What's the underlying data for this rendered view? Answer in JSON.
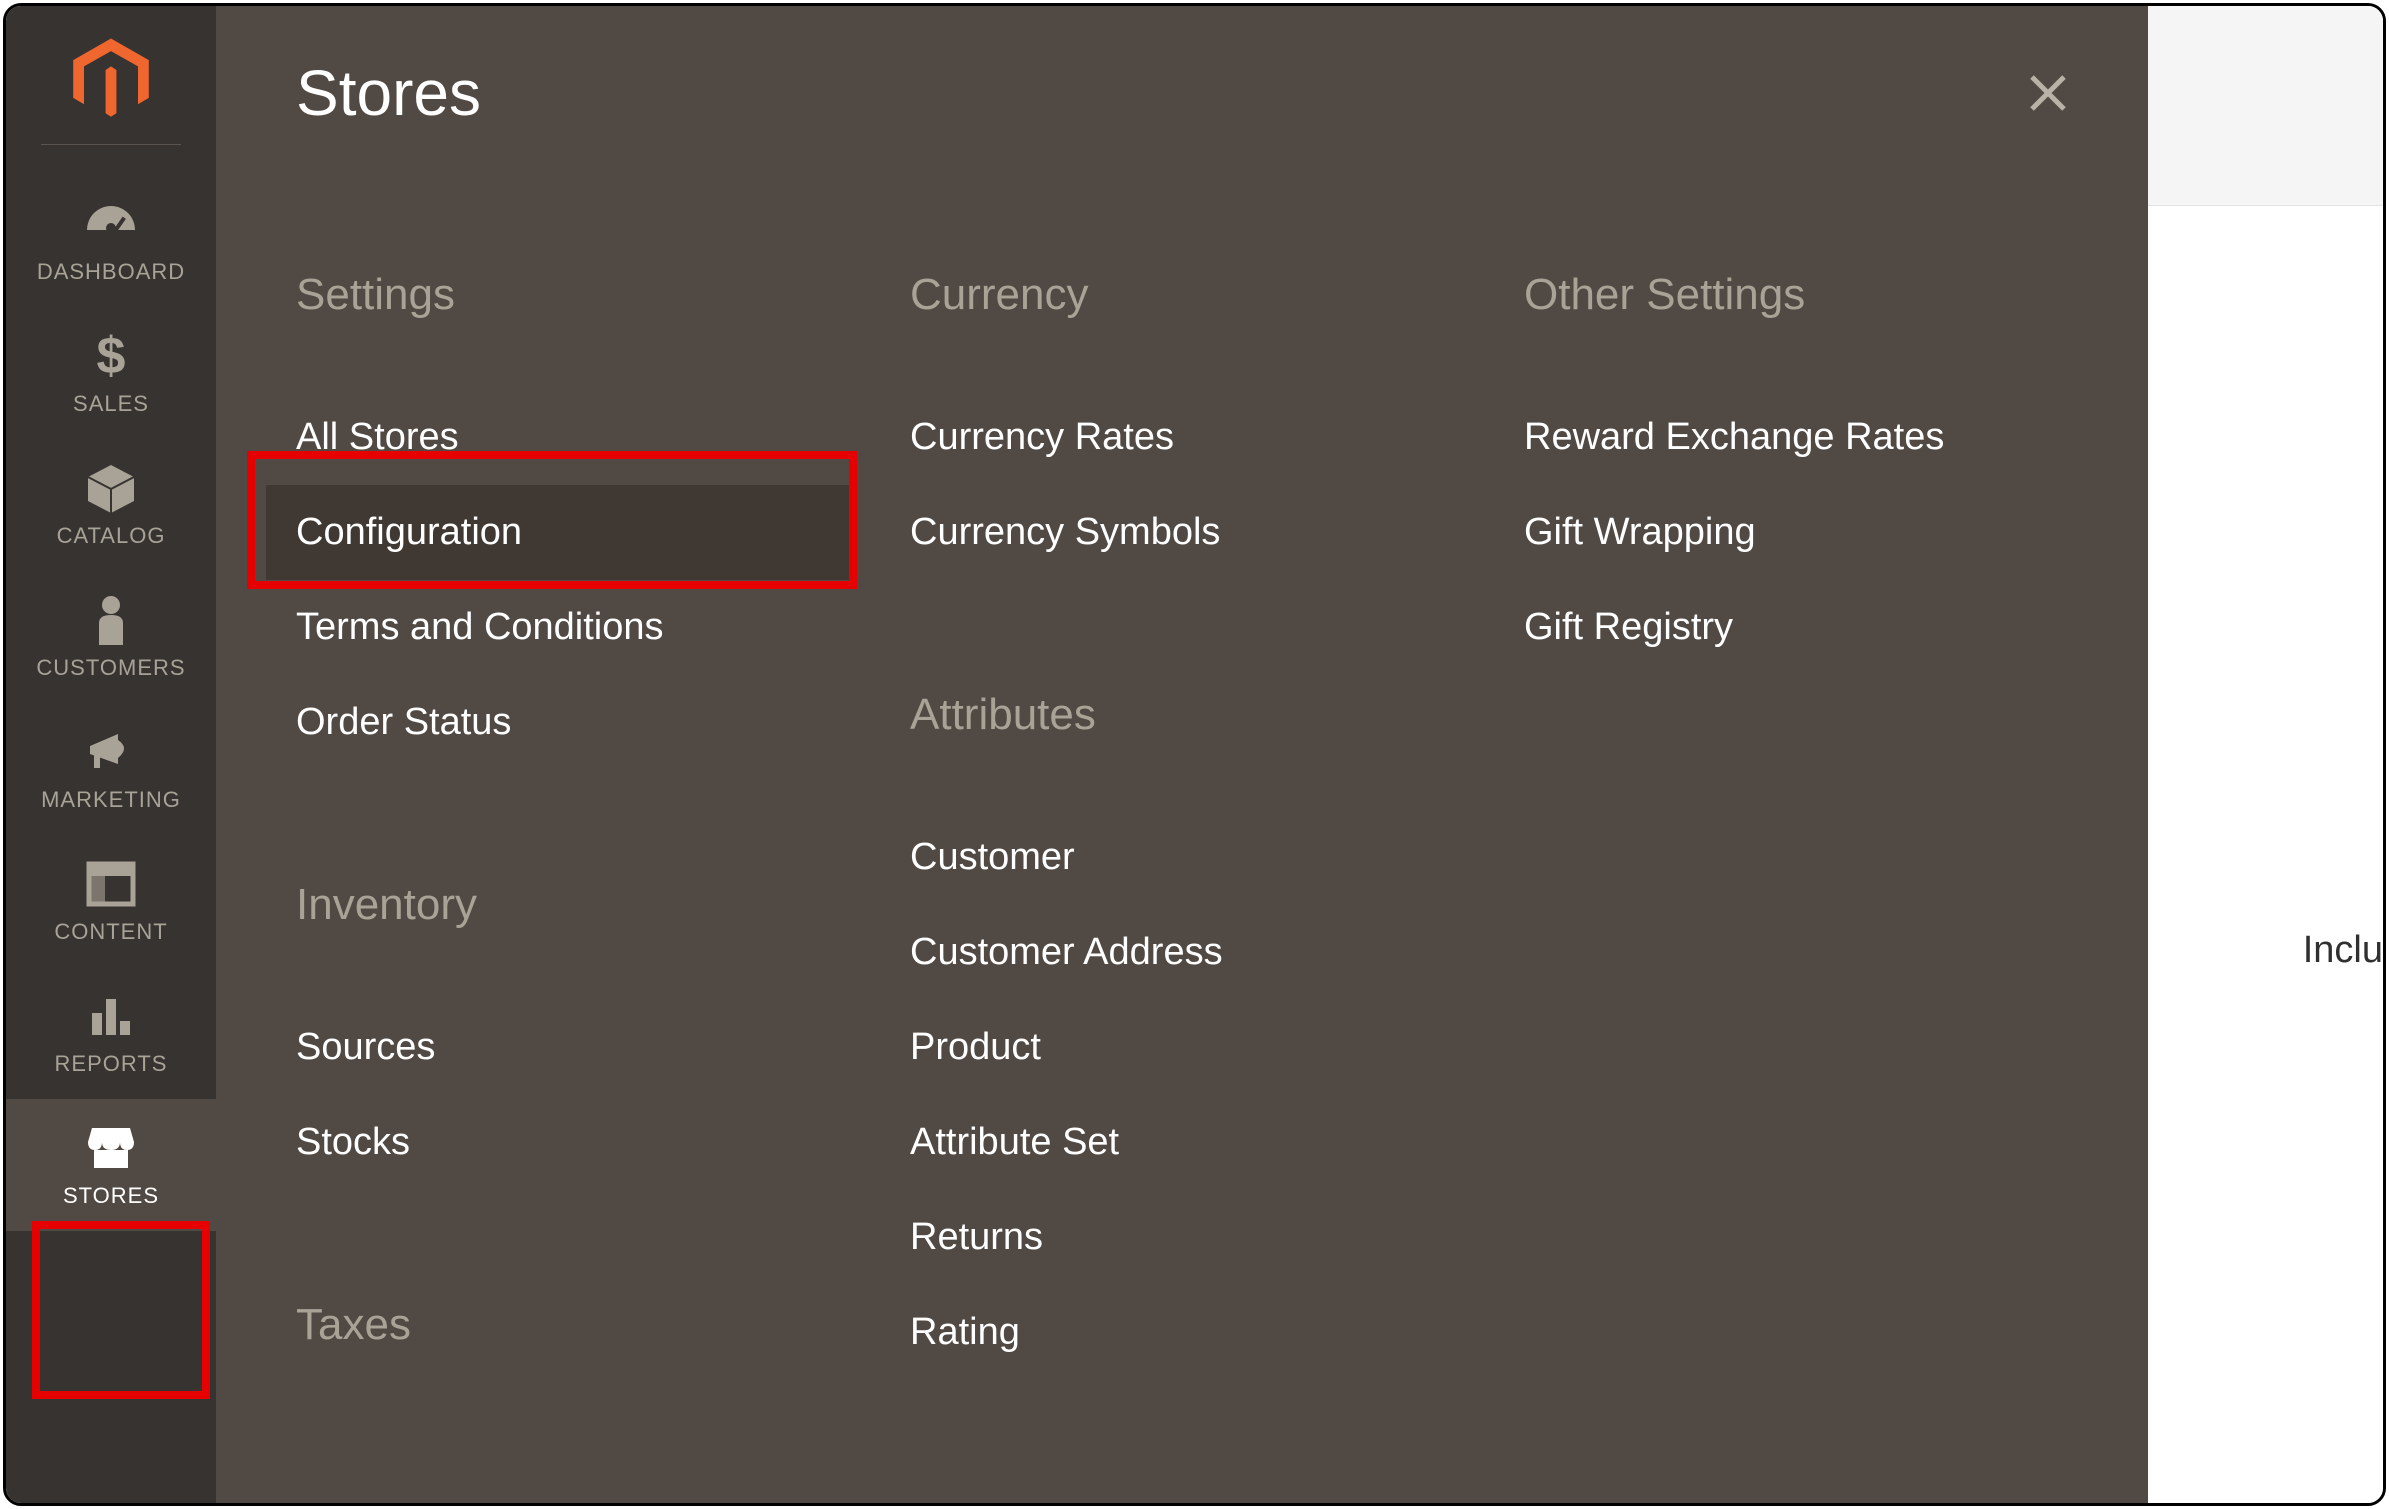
{
  "sidebar": {
    "items": [
      {
        "label": "DASHBOARD"
      },
      {
        "label": "SALES"
      },
      {
        "label": "CATALOG"
      },
      {
        "label": "CUSTOMERS"
      },
      {
        "label": "MARKETING"
      },
      {
        "label": "CONTENT"
      },
      {
        "label": "REPORTS"
      },
      {
        "label": "STORES"
      }
    ]
  },
  "flyout": {
    "title": "Stores",
    "columns": [
      {
        "groups": [
          {
            "heading": "Settings",
            "links": [
              "All Stores",
              "Configuration",
              "Terms and Conditions",
              "Order Status"
            ]
          },
          {
            "heading": "Inventory",
            "links": [
              "Sources",
              "Stocks"
            ]
          },
          {
            "heading": "Taxes",
            "links": []
          }
        ]
      },
      {
        "groups": [
          {
            "heading": "Currency",
            "links": [
              "Currency Rates",
              "Currency Symbols"
            ]
          },
          {
            "heading": "Attributes",
            "links": [
              "Customer",
              "Customer Address",
              "Product",
              "Attribute Set",
              "Returns",
              "Rating"
            ]
          }
        ]
      },
      {
        "groups": [
          {
            "heading": "Other Settings",
            "links": [
              "Reward Exchange Rates",
              "Gift Wrapping",
              "Gift Registry"
            ]
          }
        ]
      }
    ]
  },
  "background_peek_text": "Inclu"
}
